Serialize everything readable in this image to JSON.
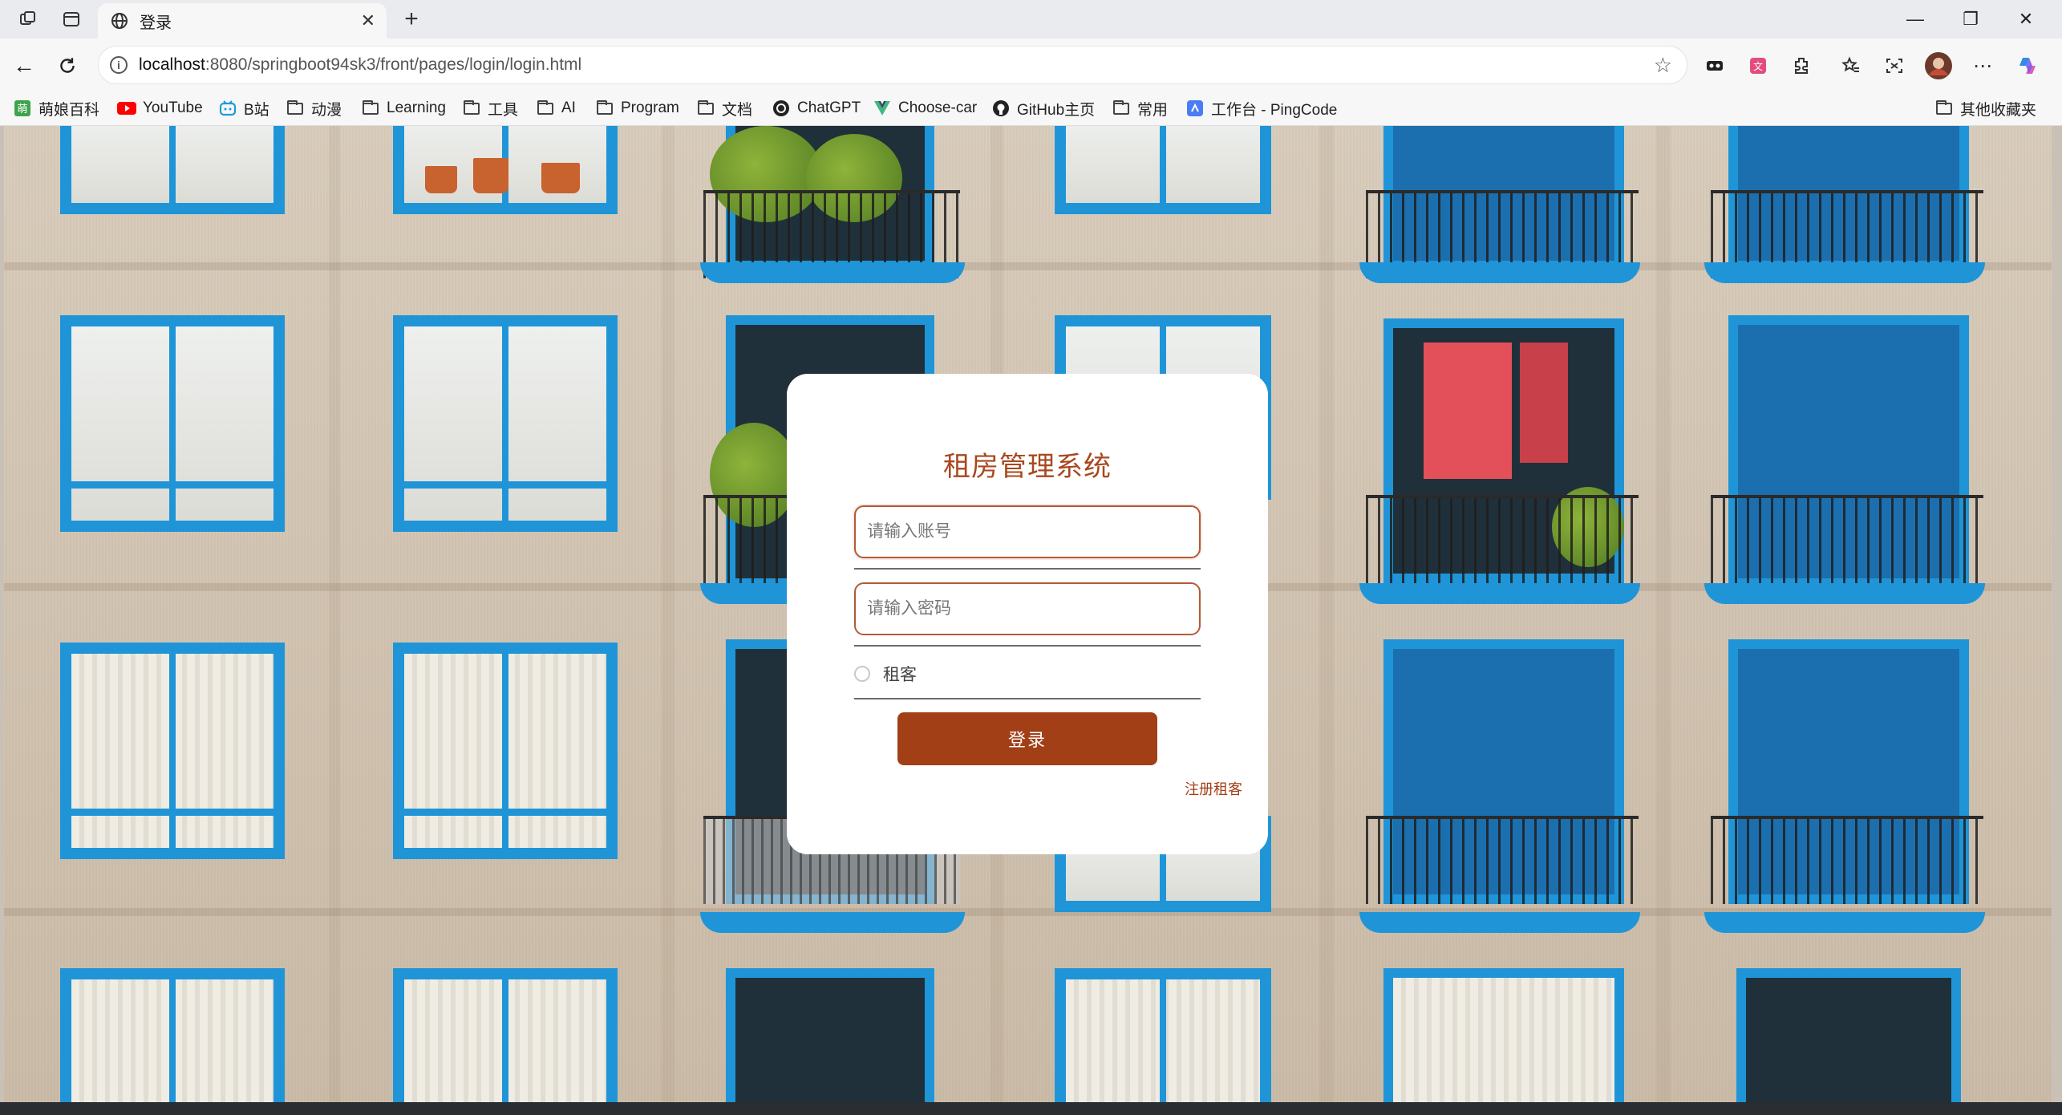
{
  "browser": {
    "tab_title": "登录",
    "url_host": "localhost",
    "url_rest": ":8080/springboot94sk3/front/pages/login/login.html",
    "window_controls": {
      "minimize": "—",
      "restore": "❐",
      "close": "✕"
    },
    "bookmarks": [
      {
        "label": "萌娘百科",
        "icon": "moegirl-icon"
      },
      {
        "label": "YouTube",
        "icon": "youtube-icon"
      },
      {
        "label": "B站",
        "icon": "bilibili-icon"
      },
      {
        "label": "动漫",
        "icon": "folder-icon"
      },
      {
        "label": "Learning",
        "icon": "folder-icon"
      },
      {
        "label": "工具",
        "icon": "folder-icon"
      },
      {
        "label": "AI",
        "icon": "folder-icon"
      },
      {
        "label": "Program",
        "icon": "folder-icon"
      },
      {
        "label": "文档",
        "icon": "folder-icon"
      },
      {
        "label": "ChatGPT",
        "icon": "chatgpt-icon"
      },
      {
        "label": "Choose-car",
        "icon": "vue-icon"
      },
      {
        "label": "GitHub主页",
        "icon": "github-icon"
      },
      {
        "label": "常用",
        "icon": "folder-icon"
      },
      {
        "label": "工作台 - PingCode",
        "icon": "pingcode-icon"
      }
    ],
    "other_bookmarks": "其他收藏夹"
  },
  "login": {
    "title": "租房管理系统",
    "username_placeholder": "请输入账号",
    "password_placeholder": "请输入密码",
    "role_option": "租客",
    "role_selected": false,
    "submit_label": "登录",
    "register_link": "注册租客"
  },
  "colors": {
    "accent": "#a23f17",
    "title": "#a7481f",
    "window_frame_blue": "#1f95d8"
  }
}
